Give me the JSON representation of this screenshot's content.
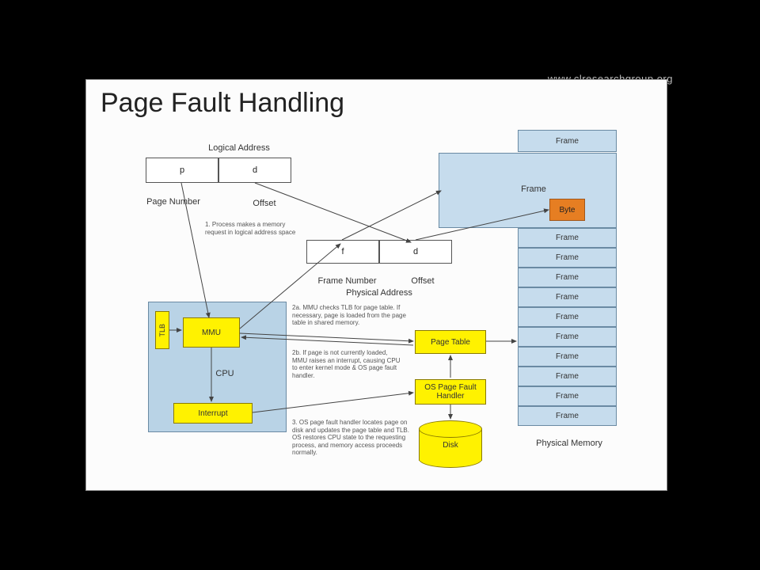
{
  "watermark": "www.clresearchgroup.org",
  "title": "Page Fault Handling",
  "logical_address": {
    "heading": "Logical Address",
    "p": "p",
    "d": "d",
    "page_number": "Page Number",
    "offset": "Offset"
  },
  "physical_address": {
    "f": "f",
    "d": "d",
    "frame_number": "Frame Number",
    "offset": "Offset",
    "heading": "Physical Address"
  },
  "cpu": {
    "tlb": "TLB",
    "mmu": "MMU",
    "label": "CPU",
    "interrupt": "Interrupt"
  },
  "page_table": "Page Table",
  "os_handler": "OS Page Fault Handler",
  "disk": "Disk",
  "note1": "1. Process makes a memory request in logical address space",
  "note2": "2a. MMU checks TLB for page table. If necessary, page is loaded from the page table in shared memory.",
  "note3": "2b. If page is not currently loaded, MMU raises an interrupt, causing CPU to enter kernel mode & OS page fault handler.",
  "note4": "3. OS page fault handler locates page on disk and updates the page table and TLB. OS restores CPU state to the requesting process, and memory access proceeds normally.",
  "pm": {
    "label": "Physical Memory",
    "frame": "Frame",
    "byte": "Byte"
  }
}
